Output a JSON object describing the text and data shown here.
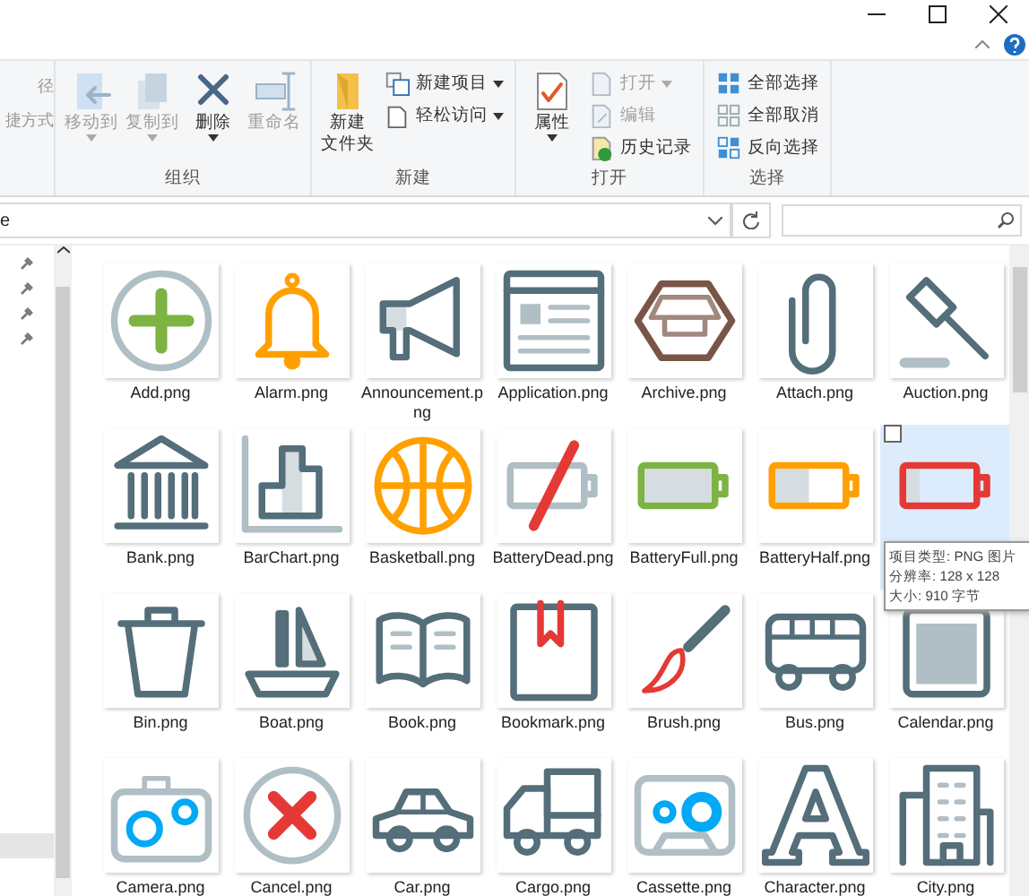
{
  "ribbon": {
    "cut_group_items": [
      "径",
      "捷方式"
    ],
    "groups": [
      {
        "label": "组织",
        "items": [
          {
            "kind": "large",
            "label": "移动到",
            "disabled": true,
            "dropdown": true
          },
          {
            "kind": "large",
            "label": "复制到",
            "disabled": true,
            "dropdown": true
          },
          {
            "kind": "large",
            "label": "删除",
            "disabled": false,
            "dropdown": true
          },
          {
            "kind": "large",
            "label": "重命名",
            "disabled": true,
            "dropdown": false
          }
        ]
      },
      {
        "label": "新建",
        "items": [
          {
            "kind": "large",
            "label": [
              "新建",
              "文件夹"
            ],
            "disabled": false,
            "dropdown": false
          },
          {
            "kind": "small",
            "label": "新建项目",
            "disabled": false,
            "dropdown": true
          },
          {
            "kind": "small",
            "label": "轻松访问",
            "disabled": false,
            "dropdown": true
          }
        ]
      },
      {
        "label": "打开",
        "items": [
          {
            "kind": "large",
            "label": "属性",
            "disabled": false,
            "dropdown": true
          },
          {
            "kind": "small",
            "label": "打开",
            "disabled": true,
            "dropdown": true
          },
          {
            "kind": "small",
            "label": "编辑",
            "disabled": true,
            "dropdown": false
          },
          {
            "kind": "small",
            "label": "历史记录",
            "disabled": false,
            "dropdown": false
          }
        ]
      },
      {
        "label": "选择",
        "items": [
          {
            "kind": "small",
            "label": "全部选择",
            "disabled": false,
            "dropdown": false
          },
          {
            "kind": "small",
            "label": "全部取消",
            "disabled": false,
            "dropdown": false
          },
          {
            "kind": "small",
            "label": "反向选择",
            "disabled": false,
            "dropdown": false
          }
        ]
      }
    ]
  },
  "address_bar": {
    "value": "e"
  },
  "files": [
    {
      "name": "Add.png",
      "selected": false
    },
    {
      "name": "Alarm.png",
      "selected": false
    },
    {
      "name": "Announcement.png",
      "selected": false
    },
    {
      "name": "Application.png",
      "selected": false
    },
    {
      "name": "Archive.png",
      "selected": false
    },
    {
      "name": "Attach.png",
      "selected": false
    },
    {
      "name": "Auction.png",
      "selected": false
    },
    {
      "name": "Bank.png",
      "selected": false
    },
    {
      "name": "BarChart.png",
      "selected": false
    },
    {
      "name": "Basketball.png",
      "selected": false
    },
    {
      "name": "BatteryDead.png",
      "selected": false
    },
    {
      "name": "BatteryFull.png",
      "selected": false
    },
    {
      "name": "BatteryHalf.png",
      "selected": false
    },
    {
      "selected": true
    },
    {
      "name": "Bin.png",
      "selected": false
    },
    {
      "name": "Boat.png",
      "selected": false
    },
    {
      "name": "Book.png",
      "selected": false
    },
    {
      "name": "Bookmark.png",
      "selected": false
    },
    {
      "name": "Brush.png",
      "selected": false
    },
    {
      "name": "Bus.png",
      "selected": false
    },
    {
      "name": "Calendar.png",
      "selected": false
    },
    {
      "name": "Camera.png",
      "selected": false
    },
    {
      "name": "Cancel.png",
      "selected": false
    },
    {
      "name": "Car.png",
      "selected": false
    },
    {
      "name": "Cargo.png",
      "selected": false
    },
    {
      "name": "Cassette.png",
      "selected": false
    },
    {
      "name": "Character.png",
      "selected": false
    },
    {
      "name": "City.png",
      "selected": false
    }
  ],
  "tooltip": {
    "lines": [
      "项目类型: PNG 图片",
      "分辨率: 128 x 128",
      "大小: 910 字节"
    ]
  }
}
